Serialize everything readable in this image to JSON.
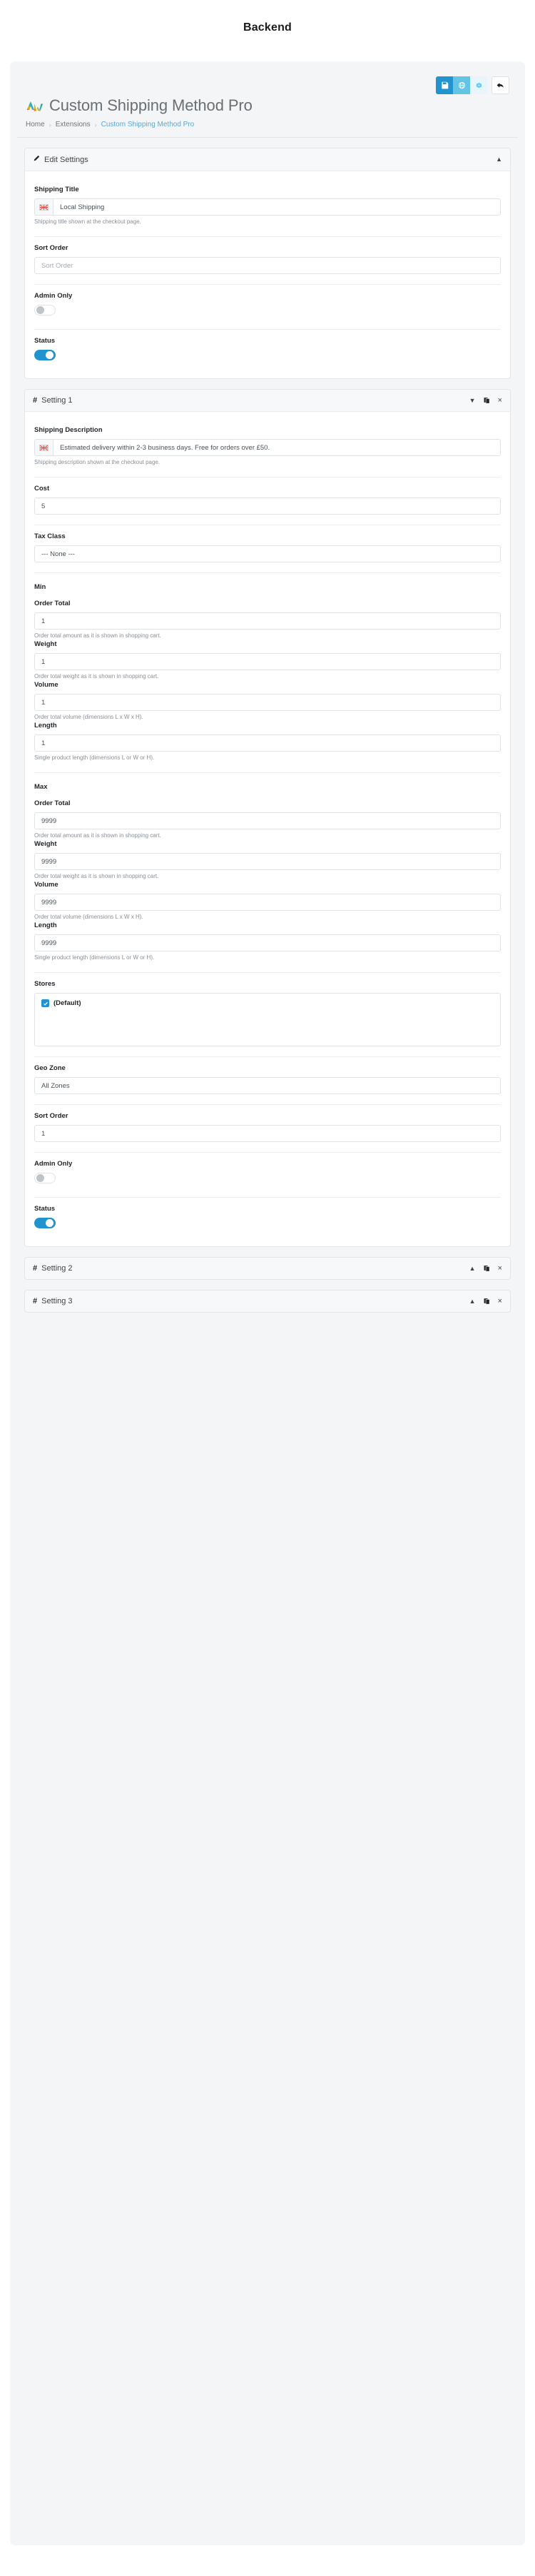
{
  "page": {
    "heading": "Backend"
  },
  "header": {
    "title": "Custom Shipping Method Pro",
    "logo_icon": "aw-logo-icon",
    "toolbar": {
      "save_label": "save-icon",
      "mid_label": "globe-icon",
      "gear_label": "gear-icon",
      "back_label": "back-arrow-icon"
    },
    "breadcrumb": [
      {
        "label": "Home",
        "active": false
      },
      {
        "label": "Extensions",
        "active": false
      },
      {
        "label": "Custom Shipping Method Pro",
        "active": true
      }
    ],
    "breadcrumb_separator": "›"
  },
  "edit_settings": {
    "panel_title": "Edit Settings",
    "panel_icon": "pencil-icon",
    "collapse_icon": "caret-up-icon",
    "shipping_title": {
      "label": "Shipping Title",
      "value": "Local Shipping",
      "help": "Shipping title shown at the checkout page.",
      "flag": "uk-flag-icon"
    },
    "sort_order": {
      "label": "Sort Order",
      "value": "",
      "placeholder": "Sort Order"
    },
    "admin_only": {
      "label": "Admin Only",
      "state": "off"
    },
    "status": {
      "label": "Status",
      "state": "on"
    }
  },
  "settings": [
    {
      "title": "Setting 1",
      "hash_icon": "hash-icon",
      "collapse_icon": "caret-down-icon",
      "copy_icon": "copy-icon",
      "close_icon": "close-icon",
      "expanded": true,
      "shipping_description": {
        "label": "Shipping Description",
        "value": "Estimated delivery within 2-3 business days. Free for orders over £50.",
        "help": "Shipping description shown at the checkout page.",
        "flag": "uk-flag-icon"
      },
      "cost": {
        "label": "Cost",
        "value": "5"
      },
      "tax_class": {
        "label": "Tax Class",
        "value": "--- None ---"
      },
      "min": {
        "group_label": "Min",
        "fields": [
          {
            "label": "Order Total",
            "value": "1",
            "help": "Order total amount as it is shown in shopping cart."
          },
          {
            "label": "Weight",
            "value": "1",
            "help": "Order total weight as it is shown in shopping cart."
          },
          {
            "label": "Volume",
            "value": "1",
            "help": "Order total volume (dimensions L x W x H)."
          },
          {
            "label": "Length",
            "value": "1",
            "help": "Single product length (dimensions L or W or H)."
          }
        ]
      },
      "max": {
        "group_label": "Max",
        "fields": [
          {
            "label": "Order Total",
            "value": "9999",
            "help": "Order total amount as it is shown in shopping cart."
          },
          {
            "label": "Weight",
            "value": "9999",
            "help": "Order total weight as it is shown in shopping cart."
          },
          {
            "label": "Volume",
            "value": "9999",
            "help": "Order total volume (dimensions L x W x H)."
          },
          {
            "label": "Length",
            "value": "9999",
            "help": "Single product length (dimensions L or W or H)."
          }
        ]
      },
      "stores": {
        "label": "Stores",
        "options": [
          {
            "label": "(Default)",
            "checked": true
          }
        ]
      },
      "geo_zone": {
        "label": "Geo Zone",
        "value": "All Zones"
      },
      "sort_order": {
        "label": "Sort Order",
        "value": "1"
      },
      "admin_only": {
        "label": "Admin Only",
        "state": "off"
      },
      "status": {
        "label": "Status",
        "state": "on"
      }
    },
    {
      "title": "Setting 2",
      "hash_icon": "hash-icon",
      "collapse_icon": "caret-up-icon",
      "copy_icon": "copy-icon",
      "close_icon": "close-icon",
      "expanded": false
    },
    {
      "title": "Setting 3",
      "hash_icon": "hash-icon",
      "collapse_icon": "caret-up-icon",
      "copy_icon": "copy-icon",
      "close_icon": "close-icon",
      "expanded": false
    }
  ],
  "glyphs": {
    "hash": "#",
    "caret_up": "▲",
    "caret_down": "▼",
    "close": "×"
  },
  "colors": {
    "accent": "#2193cf",
    "accent_mid": "#64c4e3",
    "accent_light": "#e8f6fc",
    "link": "#5aa7d8",
    "text": "#22262a",
    "muted": "#8a9097",
    "panel_bg": "#f7f8f9",
    "shell_bg": "#f4f5f6",
    "border": "#e3e5e7"
  }
}
